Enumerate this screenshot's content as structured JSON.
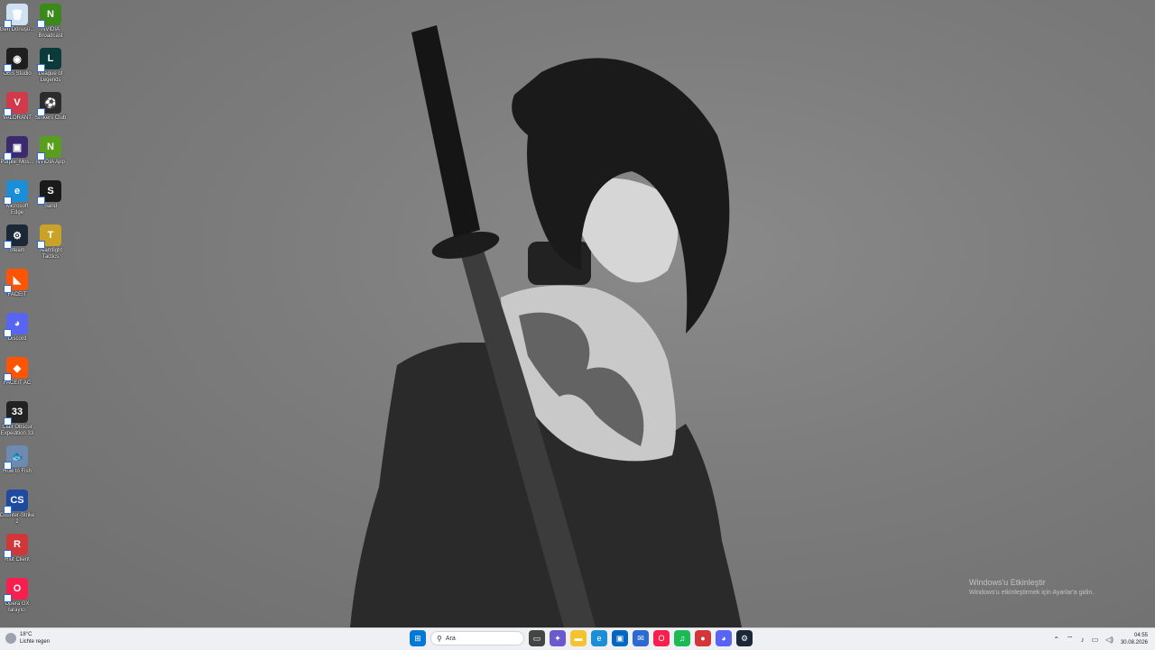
{
  "desktop_icons": [
    {
      "name": "recycle-bin",
      "label": "Geri Dönüşü...",
      "glyph": "🗑",
      "color": "#cfe2f3"
    },
    {
      "name": "nvidia-broadcast",
      "label": "NVIDIA Broadcast",
      "glyph": "N",
      "color": "#3a8a1a"
    },
    {
      "name": "obs-studio",
      "label": "OBS Studio",
      "glyph": "◉",
      "color": "#1e1e1e"
    },
    {
      "name": "league-of-legends",
      "label": "League of Legends",
      "glyph": "L",
      "color": "#0b3a3a"
    },
    {
      "name": "valorant",
      "label": "VALORANT",
      "glyph": "V",
      "color": "#d23a4a"
    },
    {
      "name": "strikers-club",
      "label": "Strikers Club",
      "glyph": "⚽",
      "color": "#2b2b2b"
    },
    {
      "name": "purple-mos",
      "label": "Purple_Mos...",
      "glyph": "▣",
      "color": "#3b2a6e"
    },
    {
      "name": "nvidia-app",
      "label": "NVIDIA App",
      "glyph": "N",
      "color": "#5a9e1e"
    },
    {
      "name": "microsoft-edge",
      "label": "Microsoft Edge",
      "glyph": "e",
      "color": "#1a8fd8"
    },
    {
      "name": "sand",
      "label": "Sand",
      "glyph": "S",
      "color": "#1a1a1a"
    },
    {
      "name": "steam",
      "label": "Steam",
      "glyph": "⚙",
      "color": "#1b2838"
    },
    {
      "name": "teamfight-tactics",
      "label": "Teamfight Tactics",
      "glyph": "T",
      "color": "#c9a227"
    },
    {
      "name": "faceit",
      "label": "FACEIT",
      "glyph": "◣",
      "color": "#ff5500"
    },
    {
      "name": "discord",
      "label": "Discord",
      "glyph": "◕",
      "color": "#5865f2"
    },
    {
      "name": "faceit-ac",
      "label": "FACEIT AC",
      "glyph": "◆",
      "color": "#ff5500"
    },
    {
      "name": "clair-obscur",
      "label": "Clair Obscur Expedition 33",
      "glyph": "33",
      "color": "#222"
    },
    {
      "name": "how-to-fish",
      "label": "How to Fish",
      "glyph": "🐟",
      "color": "#6b8bb0"
    },
    {
      "name": "counter-strike-2",
      "label": "Counter-Strike 2",
      "glyph": "CS",
      "color": "#1e4aa0"
    },
    {
      "name": "riot-client",
      "label": "Riot Client",
      "glyph": "R",
      "color": "#d13639"
    },
    {
      "name": "opera-gx",
      "label": "Opera GX tarayıcı",
      "glyph": "O",
      "color": "#fa1e4e"
    }
  ],
  "activation": {
    "title": "Windows'u Etkinleştir",
    "subtitle": "Windows'u etkinleştirmek için Ayarlar'a gidin."
  },
  "taskbar": {
    "weather_temp": "18°C",
    "weather_desc": "Lichte regen",
    "search_placeholder": "Ara",
    "pinned": [
      {
        "name": "start-button",
        "glyph": "⊞",
        "color": "#0078d4"
      },
      {
        "name": "task-view-button",
        "glyph": "▭",
        "color": "#444"
      },
      {
        "name": "copilot-button",
        "glyph": "✦",
        "color": "#6a5acd"
      },
      {
        "name": "file-explorer-button",
        "glyph": "▬",
        "color": "#f4c430"
      },
      {
        "name": "edge-taskbar-button",
        "glyph": "e",
        "color": "#1a8fd8"
      },
      {
        "name": "store-button",
        "glyph": "▣",
        "color": "#0067c0"
      },
      {
        "name": "mail-button",
        "glyph": "✉",
        "color": "#2a6ad1"
      },
      {
        "name": "opera-gx-taskbar-button",
        "glyph": "O",
        "color": "#fa1e4e"
      },
      {
        "name": "spotify-button",
        "glyph": "♫",
        "color": "#1db954"
      },
      {
        "name": "riot-taskbar-button",
        "glyph": "●",
        "color": "#d13639"
      },
      {
        "name": "discord-taskbar-button",
        "glyph": "◕",
        "color": "#5865f2"
      },
      {
        "name": "steam-taskbar-button",
        "glyph": "⚙",
        "color": "#1b2838"
      }
    ],
    "time": "04:55",
    "date": "30.08.2026"
  }
}
